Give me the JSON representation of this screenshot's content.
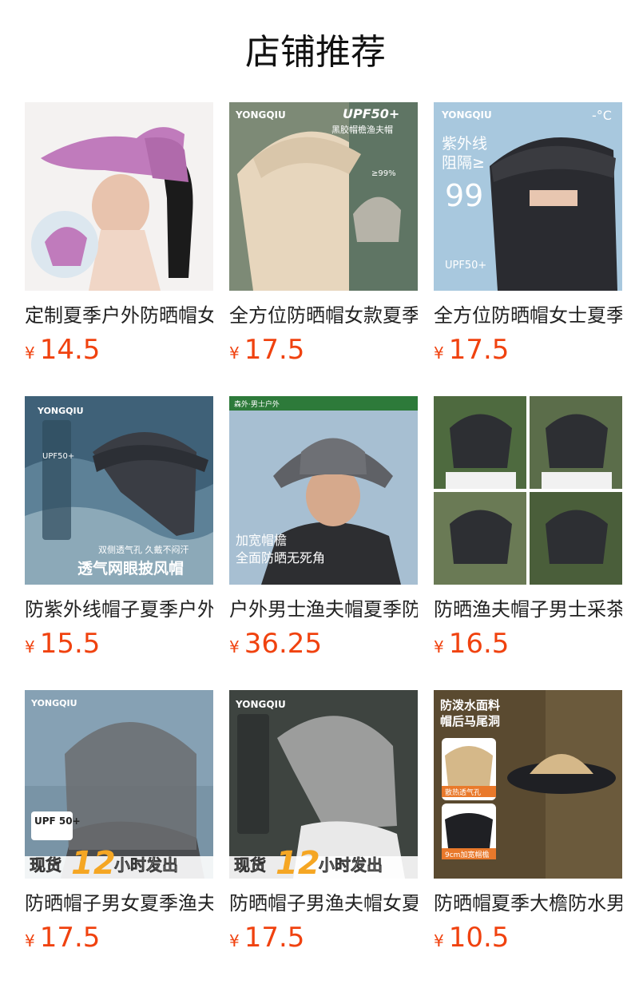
{
  "section_title": "店铺推荐",
  "currency": "¥",
  "products": [
    {
      "name": "定制夏季户外防晒帽女",
      "price": "14.5",
      "image": {
        "bg": "#f4f2f1",
        "hat": "#c07bbc",
        "overlay": []
      }
    },
    {
      "name": "全方位防晒帽女款夏季",
      "price": "17.5",
      "image": {
        "bg": "#7d8a76",
        "hat": "#e7d6bd",
        "overlay": [
          "YONGQIU",
          "UPF50+",
          "黑胶帽檐渔夫帽",
          "≥99%"
        ]
      }
    },
    {
      "name": "全方位防晒帽女士夏季",
      "price": "17.5",
      "image": {
        "bg": "#a8c8de",
        "hat": "#2a2b30",
        "overlay": [
          "YONGQIU",
          "-°C",
          "紫外线",
          "阻隔≥",
          "99",
          "UPF50+"
        ]
      }
    },
    {
      "name": "防紫外线帽子夏季户外",
      "price": "15.5",
      "image": {
        "bg": "#3f6178",
        "hat": "#3a3d44",
        "overlay": [
          "YONGQIU",
          "UPF50+",
          "双侧透气孔 久戴不闷汗",
          "透气网眼披风帽"
        ]
      }
    },
    {
      "name": "户外男士渔夫帽夏季防",
      "price": "36.25",
      "image": {
        "bg": "#a7bfd2",
        "hat": "#5f6166",
        "overlay": [
          "森外·男士户外",
          "加宽帽檐",
          "全面防晒无死角"
        ]
      }
    },
    {
      "name": "防晒渔夫帽子男士采茶",
      "price": "16.5",
      "image": {
        "bg": "#4e6a3f",
        "hat": "#2d2f33",
        "overlay": []
      }
    },
    {
      "name": "防晒帽子男女夏季渔夫",
      "price": "17.5",
      "image": {
        "bg": "#86a1b4",
        "hat": "#6b6d70",
        "overlay": [
          "YONGQIU",
          "UPF 50+",
          "现货",
          "12",
          "小时发出"
        ]
      }
    },
    {
      "name": "防晒帽子男渔夫帽女夏",
      "price": "17.5",
      "image": {
        "bg": "#3e4440",
        "hat": "#9c9d9c",
        "overlay": [
          "YONGQIU",
          "现货",
          "12",
          "小时发出"
        ]
      }
    },
    {
      "name": "防晒帽夏季大檐防水男",
      "price": "10.5",
      "image": {
        "bg": "#5a4a30",
        "hat": "#1f2024",
        "overlay": [
          "防泼水面料",
          "帽后马尾洞",
          "散热透气孔",
          "9cm加宽帽檐"
        ]
      }
    }
  ]
}
